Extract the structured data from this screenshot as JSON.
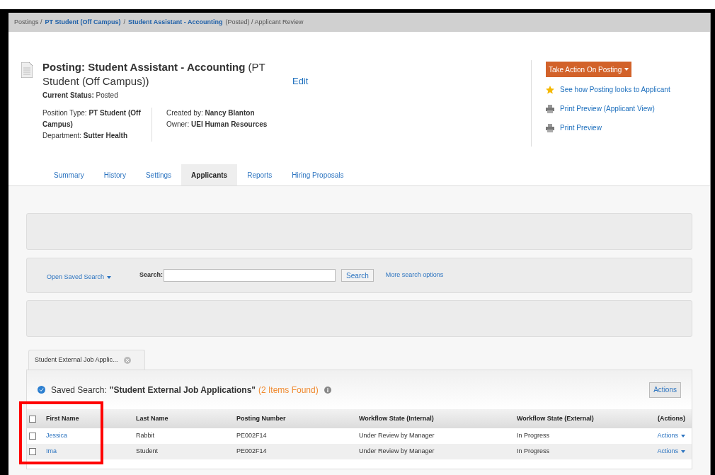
{
  "breadcrumb": [
    {
      "text": "Postings /",
      "kind": "plain"
    },
    {
      "text": "PT Student (Off Campus)",
      "kind": "link"
    },
    {
      "text": "/",
      "kind": "plain"
    },
    {
      "text": "Student Assistant - Accounting",
      "kind": "link"
    },
    {
      "text": "(Posted) / Applicant Review",
      "kind": "plain"
    }
  ],
  "posting": {
    "title": "**Posting: Student Assistant - Accounting** (PT Student (Off Campus))",
    "edit": "Edit",
    "status_label": "Current Status:",
    "status": "Posted"
  },
  "details_left": [
    {
      "label": "Position Type:",
      "value": "PT Student (Off Campus)"
    },
    {
      "label": "Department:",
      "value": "Sutter Health"
    }
  ],
  "details_right": [
    {
      "label": "Created by:",
      "value": "Nancy Blanton"
    },
    {
      "label": "Owner:",
      "value": "UEI Human Resources"
    }
  ],
  "take_action": "Take Action On Posting",
  "action_links": [
    {
      "label": "See how Posting looks to Applicant",
      "kind": "star"
    },
    {
      "label": "Print Preview (Applicant View)",
      "kind": "printer"
    },
    {
      "label": "Print Preview",
      "kind": "printer"
    }
  ],
  "tabs": [
    {
      "label": "Summary",
      "selected": false
    },
    {
      "label": "History",
      "selected": false
    },
    {
      "label": "Settings",
      "selected": false
    },
    {
      "label": "Applicants",
      "selected": true
    },
    {
      "label": "Reports",
      "selected": false
    },
    {
      "label": "Hiring Proposals",
      "selected": false
    }
  ],
  "search": {
    "open_saved": "Open Saved Search",
    "label": "Search:",
    "button": "Search",
    "more": "More search options"
  },
  "results_tab": "Student External Job Applic...",
  "saved_search": {
    "prefix": "Saved Search:",
    "name": "\"Student External Job Applications\"",
    "count": "(2 Items Found)",
    "actions": "Actions"
  },
  "table": {
    "columns": [
      "First Name",
      "Last Name",
      "Posting Number",
      "Workflow State (Internal)",
      "Workflow State (External)",
      "(Actions)"
    ],
    "header_checked": false,
    "rows": [
      {
        "checked": false,
        "first": "Jessica",
        "last": "Rabbit",
        "posting": "PE002F14",
        "internal": "Under Review by Manager",
        "external": "In Progress",
        "actions": "Actions"
      },
      {
        "checked": false,
        "first": "Ima",
        "last": "Student",
        "posting": "PE002F14",
        "internal": "Under Review by Manager",
        "external": "In Progress",
        "actions": "Actions"
      }
    ]
  },
  "annotation": {
    "kind": "highlight",
    "color": "#ff0000"
  }
}
